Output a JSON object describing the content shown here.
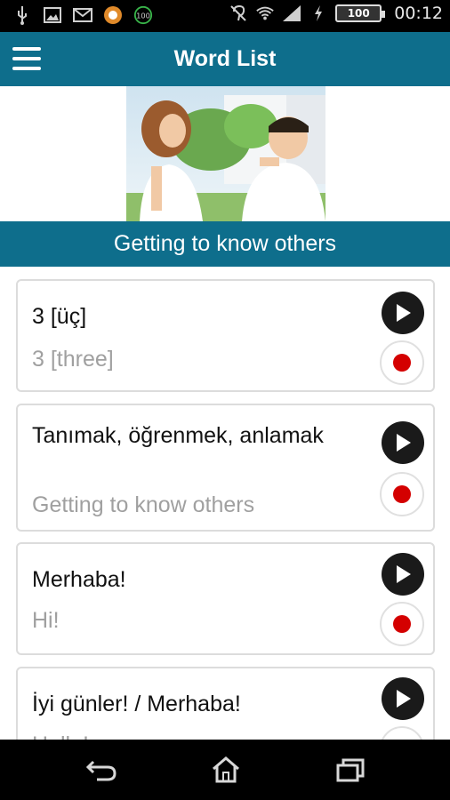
{
  "status_bar": {
    "time": "00:12",
    "battery": "100",
    "notification_badge": "100",
    "icons": [
      "usb-icon",
      "image-icon",
      "mail-icon",
      "app-icon",
      "badge-icon",
      "hearing-icon",
      "wifi-icon",
      "signal-icon",
      "charging-icon",
      "battery-icon"
    ]
  },
  "app_bar": {
    "title": "Word List",
    "menu_icon": "hamburger-menu-icon"
  },
  "hero": {
    "image": "couple-photo"
  },
  "section": {
    "title": "Getting to know others"
  },
  "cards": [
    {
      "word": "3 [üç]",
      "translation": "3 [three]"
    },
    {
      "word": "Tanımak, öğrenmek, anlamak",
      "translation": "Getting to know others"
    },
    {
      "word": "Merhaba!",
      "translation": "Hi!"
    },
    {
      "word": "İyi günler! / Merhaba!",
      "translation": "Hello!"
    }
  ],
  "nav_bar": {
    "icons": [
      "back-icon",
      "home-icon",
      "recents-icon"
    ]
  },
  "colors": {
    "primary": "#0e6e8c",
    "record": "#d40000",
    "play": "#1a1a1a"
  }
}
